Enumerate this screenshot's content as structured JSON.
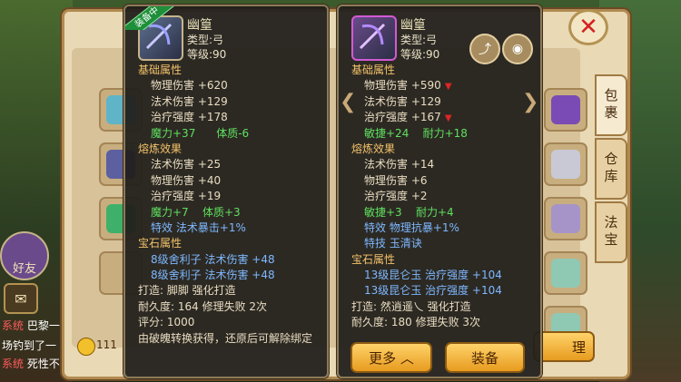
{
  "window": {
    "close_label": "✕",
    "tabs": [
      {
        "label": "包裹",
        "active": true
      },
      {
        "label": "仓库",
        "active": false
      },
      {
        "label": "法宝",
        "active": false
      }
    ],
    "coins_partial": "111",
    "left_chat": {
      "friends_label": "好友",
      "system_tag": "系统",
      "line1": "巴黎一",
      "line2": "场钓到了一",
      "line3": "死性不"
    }
  },
  "tooltip_left": {
    "badge": "装备中",
    "name": "幽篁",
    "type_label": "类型:弓",
    "level_label": "等级:90",
    "base_title": "基础属性",
    "base": [
      {
        "label": "物理伤害",
        "value": "+620"
      },
      {
        "label": "法术伤害",
        "value": "+129"
      },
      {
        "label": "治疗强度",
        "value": "+178"
      }
    ],
    "base_extra": [
      "魔力+37",
      "体质-6"
    ],
    "refine_title": "熔炼效果",
    "refine": [
      {
        "label": "法术伤害",
        "value": "+25"
      },
      {
        "label": "物理伤害",
        "value": "+40"
      },
      {
        "label": "治疗强度",
        "value": "+19"
      }
    ],
    "refine_extra": [
      "魔力+7",
      "体质+3"
    ],
    "special": "特效  法术暴击+1%",
    "gem_title": "宝石属性",
    "gems": [
      "8级舍利子  法术伤害  +48",
      "8级舍利子  法术伤害  +48"
    ],
    "crafter": "打造:  脚脚    强化打造",
    "durability": "耐久度: 164  修理失败 2次",
    "score": "评分:  1000",
    "note": "由破魄转换获得，还原后可解除绑定"
  },
  "tooltip_right": {
    "name": "幽篁",
    "type_label": "类型:弓",
    "level_label": "等级:90",
    "base_title": "基础属性",
    "base": [
      {
        "label": "物理伤害",
        "value": "+590",
        "down": true
      },
      {
        "label": "法术伤害",
        "value": "+129",
        "down": false
      },
      {
        "label": "治疗强度",
        "value": "+167",
        "down": true
      }
    ],
    "base_extra": [
      "敏捷+24",
      "耐力+18"
    ],
    "refine_title": "熔炼效果",
    "refine": [
      {
        "label": "法术伤害",
        "value": "+14"
      },
      {
        "label": "物理伤害",
        "value": "+6"
      },
      {
        "label": "治疗强度",
        "value": "+2"
      }
    ],
    "refine_extra": [
      "敏捷+3",
      "耐力+4"
    ],
    "special": "特效  物理抗暴+1%",
    "skill": "特技  玉清诀",
    "gem_title": "宝石属性",
    "gems": [
      "13级昆仑玉  治疗强度  +104",
      "13级昆仑玉  治疗强度  +104"
    ],
    "crafter": "打造:  然逍遥乀  强化打造",
    "durability": "耐久度:  180  修理失败  3次",
    "more_label": "更多 ︿",
    "equip_label": "装备"
  },
  "bag_partial_label": "理"
}
